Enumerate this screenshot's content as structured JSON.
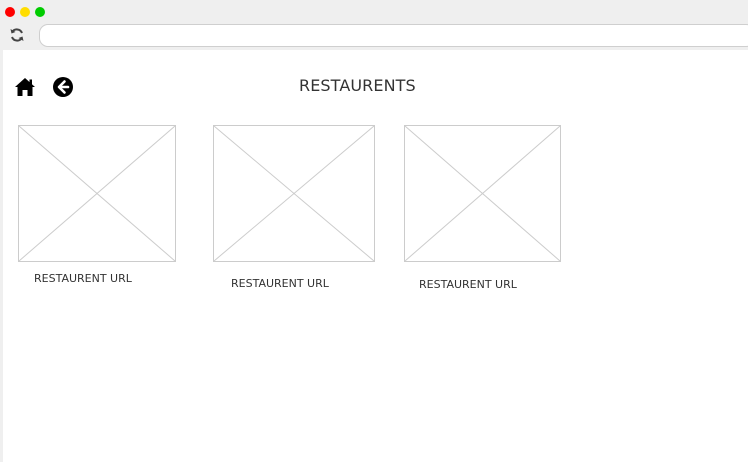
{
  "header": {
    "title": "RESTAURENTS",
    "home_icon": "home-icon",
    "back_icon": "arrow-left-circle-icon"
  },
  "browser": {
    "address_value": "",
    "reload_icon": "reload-icon",
    "traffic_colors": [
      "#ff0000",
      "#ffdd00",
      "#00cc00"
    ]
  },
  "restaurants": [
    {
      "url_label": "RESTAURENT URL",
      "image": "image-placeholder"
    },
    {
      "url_label": "RESTAURENT URL",
      "image": "image-placeholder"
    },
    {
      "url_label": "RESTAURENT URL",
      "image": "image-placeholder"
    }
  ]
}
